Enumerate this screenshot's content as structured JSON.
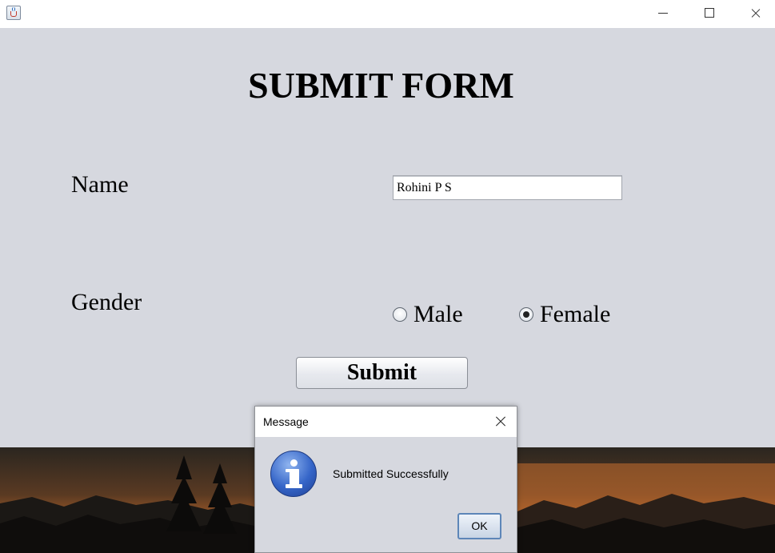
{
  "window": {
    "icon": "java-cup-icon",
    "controls": [
      "minimize",
      "maximize",
      "close"
    ]
  },
  "form": {
    "title": "SUBMIT FORM",
    "name_label": "Name",
    "name_value": "Rohini P S",
    "gender_label": "Gender",
    "gender_options": [
      {
        "label": "Male",
        "selected": false
      },
      {
        "label": "Female",
        "selected": true
      }
    ],
    "submit_label": "Submit"
  },
  "dialog": {
    "title": "Message",
    "icon": "info-icon",
    "message": "Submitted Successfully",
    "ok_label": "OK"
  },
  "colors": {
    "form_background": "#d6d8df",
    "info_icon_blue": "#3565c8",
    "ok_border": "#5d86b8"
  }
}
